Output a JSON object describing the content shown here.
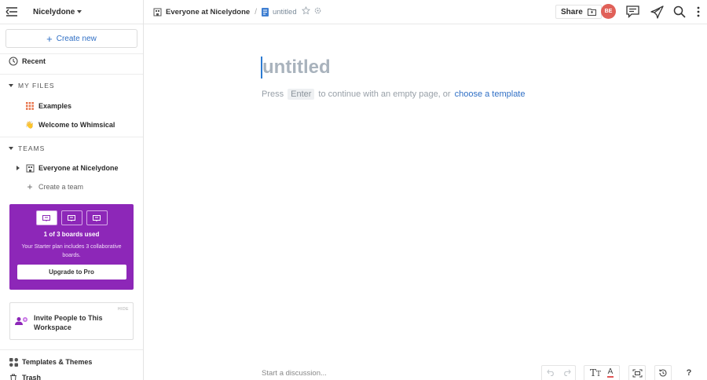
{
  "sidebar": {
    "workspace": "Nicelydone",
    "create_new": "Create new",
    "recent": "Recent",
    "my_files": "MY FILES",
    "files": [
      {
        "label": "Examples",
        "icon": "grid-icon"
      },
      {
        "label": "Welcome to Whimsical",
        "icon": "wave-hand-icon"
      }
    ],
    "teams": "TEAMS",
    "team_name": "Everyone at Nicelydone",
    "create_team": "Create a team",
    "plan": {
      "count": "1 of 3 boards used",
      "desc": "Your Starter plan includes 3 collaborative boards.",
      "upgrade": "Upgrade to Pro",
      "used_boards": 1,
      "total_boards": 3
    },
    "invite": {
      "hide": "HIDE",
      "text": "Invite People to This Workspace"
    },
    "templates": "Templates & Themes",
    "trash": "Trash"
  },
  "header": {
    "team": "Everyone at Nicelydone",
    "separator": "/",
    "doc": "untitled",
    "share": "Share",
    "avatar": "BE"
  },
  "main": {
    "title": "untitled",
    "hint_press": "Press",
    "hint_key": "Enter",
    "hint_rest": "to continue with an empty page, or",
    "hint_link": "choose a template",
    "discussion": "Start a discussion..."
  },
  "colors": {
    "accent": "#2f6fc5",
    "promo": "#8d27b8",
    "avatar": "#e06058"
  }
}
